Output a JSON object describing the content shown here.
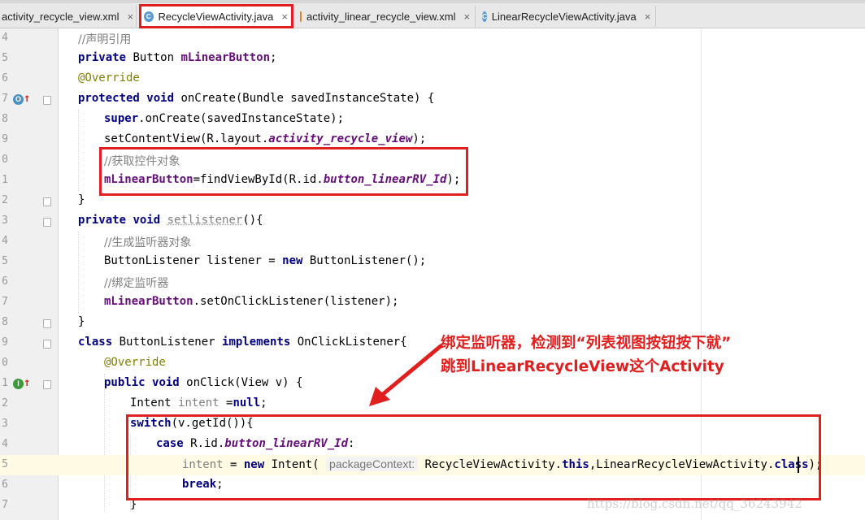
{
  "tabs": [
    {
      "label": "activity_recycle_view.xml",
      "icon": "xml-file-icon",
      "active": false
    },
    {
      "label": "RecycleViewActivity.java",
      "icon": "java-class-icon",
      "active": true
    },
    {
      "label": "activity_linear_recycle_view.xml",
      "icon": "xml-file-icon",
      "active": false
    },
    {
      "label": "LinearRecycleViewActivity.java",
      "icon": "java-class-icon",
      "active": false
    }
  ],
  "close_glyph": "×",
  "line_numbers": [
    "4",
    "5",
    "6",
    "7",
    "8",
    "9",
    "0",
    "1",
    "2",
    "3",
    "4",
    "5",
    "6",
    "7",
    "8",
    "9",
    "0",
    "1",
    "2",
    "3",
    "4",
    "5",
    "6",
    "7"
  ],
  "code": {
    "l4_comment": "//声明引用",
    "l5_private": "private",
    "l5_type": " Button ",
    "l5_field": "mLinearButton",
    "l5_end": ";",
    "l6_annotation": "@Override",
    "l7_protected": "protected",
    "l7_void": "void",
    "l7_sig": " onCreate(Bundle savedInstanceState) {",
    "l8_super": "super",
    "l8_rest": ".onCreate(savedInstanceState);",
    "l9_a": "setContentView(R.layout.",
    "l9_b": "activity_recycle_view",
    "l9_c": ");",
    "l10_comment": "//获取控件对象",
    "l11_field": "mLinearButton",
    "l11_a": "=findViewById(R.id.",
    "l11_b": "button_linearRV_Id",
    "l11_c": ");",
    "l12_brace": "}",
    "l13_private": "private",
    "l13_void": "void",
    "l13_name": "setlistener",
    "l13_rest": "(){",
    "l14_comment": "//生成监听器对象",
    "l15_a": "ButtonListener listener = ",
    "l15_new": "new",
    "l15_b": " ButtonListener();",
    "l16_comment": "//绑定监听器",
    "l17_field": "mLinearButton",
    "l17_rest": ".setOnClickListener(listener);",
    "l18_brace": "}",
    "l19_class": "class",
    "l19_name": " ButtonListener ",
    "l19_impl": "implements",
    "l19_rest": " OnClickListener{",
    "l20_annotation": "@Override",
    "l21_public": "public",
    "l21_void": "void",
    "l21_sig": " onClick(View v) {",
    "l22_type": "Intent ",
    "l22_var": "intent",
    "l22_eq": " =",
    "l22_null": "null",
    "l22_end": ";",
    "l23_switch": "switch",
    "l23_rest": "(v.getId()){",
    "l24_case": "case",
    "l24_a": " R.id.",
    "l24_b": "button_linearRV_Id",
    "l24_c": ":",
    "l25_var": "intent",
    "l25_eq": " = ",
    "l25_new": "new",
    "l25_ctor": " Intent( ",
    "l25_hint": "packageContext:",
    "l25_a": " RecycleViewActivity.",
    "l25_this": "this",
    "l25_b": ",LinearRecycleViewActivity.",
    "l25_class": "class",
    "l25_c": ");",
    "l26_break": "break",
    "l26_end": ";",
    "l27_brace": "}"
  },
  "callout": {
    "line1": "绑定监听器，检测到“列表视图按钮按下就”",
    "line2": "跳到LinearRecycleView这个Activity"
  },
  "watermark": "https://blog.csdn.net/qq_36243942",
  "colors": {
    "highlight_red": "#e0201e",
    "keyword": "#000080",
    "field": "#660e7a",
    "comment": "#808080",
    "annotation": "#808000"
  }
}
